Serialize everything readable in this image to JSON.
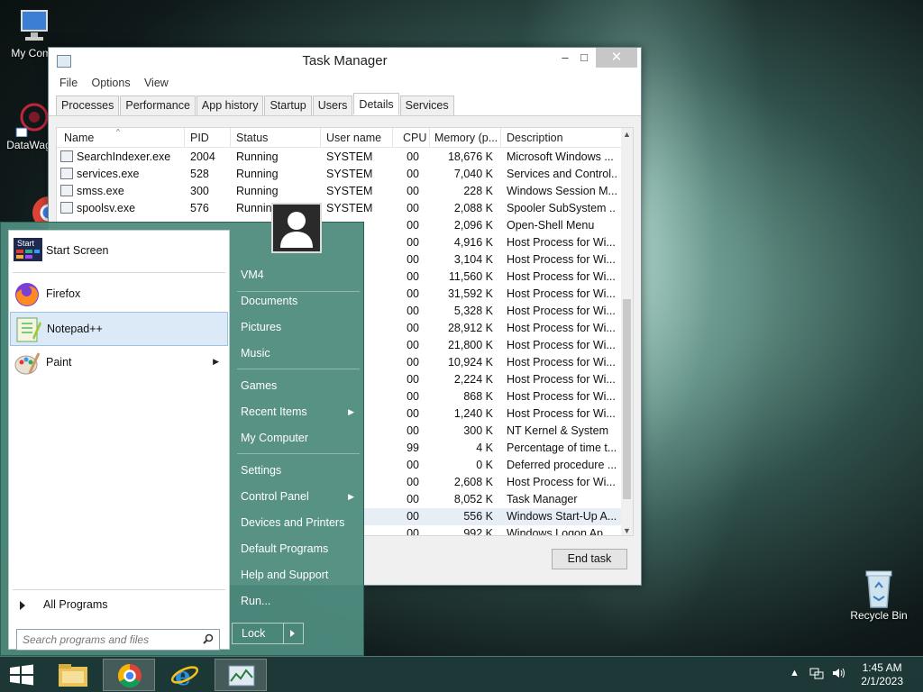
{
  "desktop": {
    "icons": [
      {
        "label": "My Comp"
      },
      {
        "label": "DataWag"
      },
      {
        "label": "Recycle Bin"
      }
    ]
  },
  "task_manager": {
    "title": "Task Manager",
    "menu": [
      "File",
      "Options",
      "View"
    ],
    "tabs": [
      "Processes",
      "Performance",
      "App history",
      "Startup",
      "Users",
      "Details",
      "Services"
    ],
    "active_tab": "Details",
    "columns": [
      "Name",
      "PID",
      "Status",
      "User name",
      "CPU",
      "Memory (p...",
      "Description"
    ],
    "rows": [
      {
        "name": "SearchIndexer.exe",
        "pid": "2004",
        "status": "Running",
        "user": "SYSTEM",
        "cpu": "00",
        "mem": "18,676 K",
        "desc": "Microsoft Windows ..."
      },
      {
        "name": "services.exe",
        "pid": "528",
        "status": "Running",
        "user": "SYSTEM",
        "cpu": "00",
        "mem": "7,040 K",
        "desc": "Services and Control..."
      },
      {
        "name": "smss.exe",
        "pid": "300",
        "status": "Running",
        "user": "SYSTEM",
        "cpu": "00",
        "mem": "228 K",
        "desc": "Windows Session M..."
      },
      {
        "name": "spoolsv.exe",
        "pid": "576",
        "status": "Runnin",
        "user": "SYSTEM",
        "cpu": "00",
        "mem": "2,088 K",
        "desc": "Spooler SubSystem ..."
      },
      {
        "name": "",
        "pid": "",
        "status": "",
        "user": "",
        "cpu": "00",
        "mem": "2,096 K",
        "desc": "Open-Shell Menu"
      },
      {
        "name": "",
        "pid": "",
        "status": "",
        "user": "",
        "cpu": "00",
        "mem": "4,916 K",
        "desc": "Host Process for Wi..."
      },
      {
        "name": "",
        "pid": "",
        "status": "",
        "user": "",
        "cpu": "00",
        "mem": "3,104 K",
        "desc": "Host Process for Wi..."
      },
      {
        "name": "",
        "pid": "",
        "status": "",
        "user": "",
        "cpu": "00",
        "mem": "11,560 K",
        "desc": "Host Process for Wi..."
      },
      {
        "name": "",
        "pid": "",
        "status": "",
        "user": "",
        "cpu": "00",
        "mem": "31,592 K",
        "desc": "Host Process for Wi..."
      },
      {
        "name": "",
        "pid": "",
        "status": "",
        "user": "",
        "cpu": "00",
        "mem": "5,328 K",
        "desc": "Host Process for Wi..."
      },
      {
        "name": "",
        "pid": "",
        "status": "",
        "user": "",
        "cpu": "00",
        "mem": "28,912 K",
        "desc": "Host Process for Wi..."
      },
      {
        "name": "",
        "pid": "",
        "status": "",
        "user": "",
        "cpu": "00",
        "mem": "21,800 K",
        "desc": "Host Process for Wi..."
      },
      {
        "name": "",
        "pid": "",
        "status": "",
        "user": "",
        "cpu": "00",
        "mem": "10,924 K",
        "desc": "Host Process for Wi..."
      },
      {
        "name": "",
        "pid": "",
        "status": "",
        "user": "",
        "cpu": "00",
        "mem": "2,224 K",
        "desc": "Host Process for Wi..."
      },
      {
        "name": "",
        "pid": "",
        "status": "",
        "user": "",
        "cpu": "00",
        "mem": "868 K",
        "desc": "Host Process for Wi..."
      },
      {
        "name": "",
        "pid": "",
        "status": "",
        "user": "",
        "cpu": "00",
        "mem": "1,240 K",
        "desc": "Host Process for Wi..."
      },
      {
        "name": "",
        "pid": "",
        "status": "",
        "user": "",
        "cpu": "00",
        "mem": "300 K",
        "desc": "NT Kernel & System"
      },
      {
        "name": "",
        "pid": "",
        "status": "",
        "user": "",
        "cpu": "99",
        "mem": "4 K",
        "desc": "Percentage of time t..."
      },
      {
        "name": "",
        "pid": "",
        "status": "",
        "user": "",
        "cpu": "00",
        "mem": "0 K",
        "desc": "Deferred procedure ..."
      },
      {
        "name": "",
        "pid": "",
        "status": "",
        "user": "",
        "cpu": "00",
        "mem": "2,608 K",
        "desc": "Host Process for Wi..."
      },
      {
        "name": "",
        "pid": "",
        "status": "",
        "user": "",
        "cpu": "00",
        "mem": "8,052 K",
        "desc": "Task Manager"
      },
      {
        "name": "",
        "pid": "",
        "status": "",
        "user": "",
        "cpu": "00",
        "mem": "556 K",
        "desc": "Windows Start-Up A..."
      },
      {
        "name": "",
        "pid": "",
        "status": "",
        "user": "",
        "cpu": "00",
        "mem": "992 K",
        "desc": "Windows Logon Ap..."
      }
    ],
    "end_task_label": "End task"
  },
  "start_menu": {
    "left_items": [
      {
        "label": "Start Screen",
        "icon": "start-screen-icon"
      },
      {
        "label": "Firefox",
        "icon": "firefox-icon"
      },
      {
        "label": "Notepad++",
        "icon": "notepad-plus-plus-icon"
      },
      {
        "label": "Paint",
        "icon": "paint-icon"
      }
    ],
    "start_icon_text": "Start",
    "all_programs": "All Programs",
    "search_placeholder": "Search programs and files",
    "right_items": [
      "VM4",
      "Documents",
      "Pictures",
      "Music",
      "Games",
      "Recent Items",
      "My Computer",
      "Settings",
      "Control Panel",
      "Devices and Printers",
      "Default Programs",
      "Help and Support",
      "Run..."
    ],
    "lock_label": "Lock"
  },
  "taskbar": {
    "time": "1:45 AM",
    "date": "2/1/2023"
  }
}
